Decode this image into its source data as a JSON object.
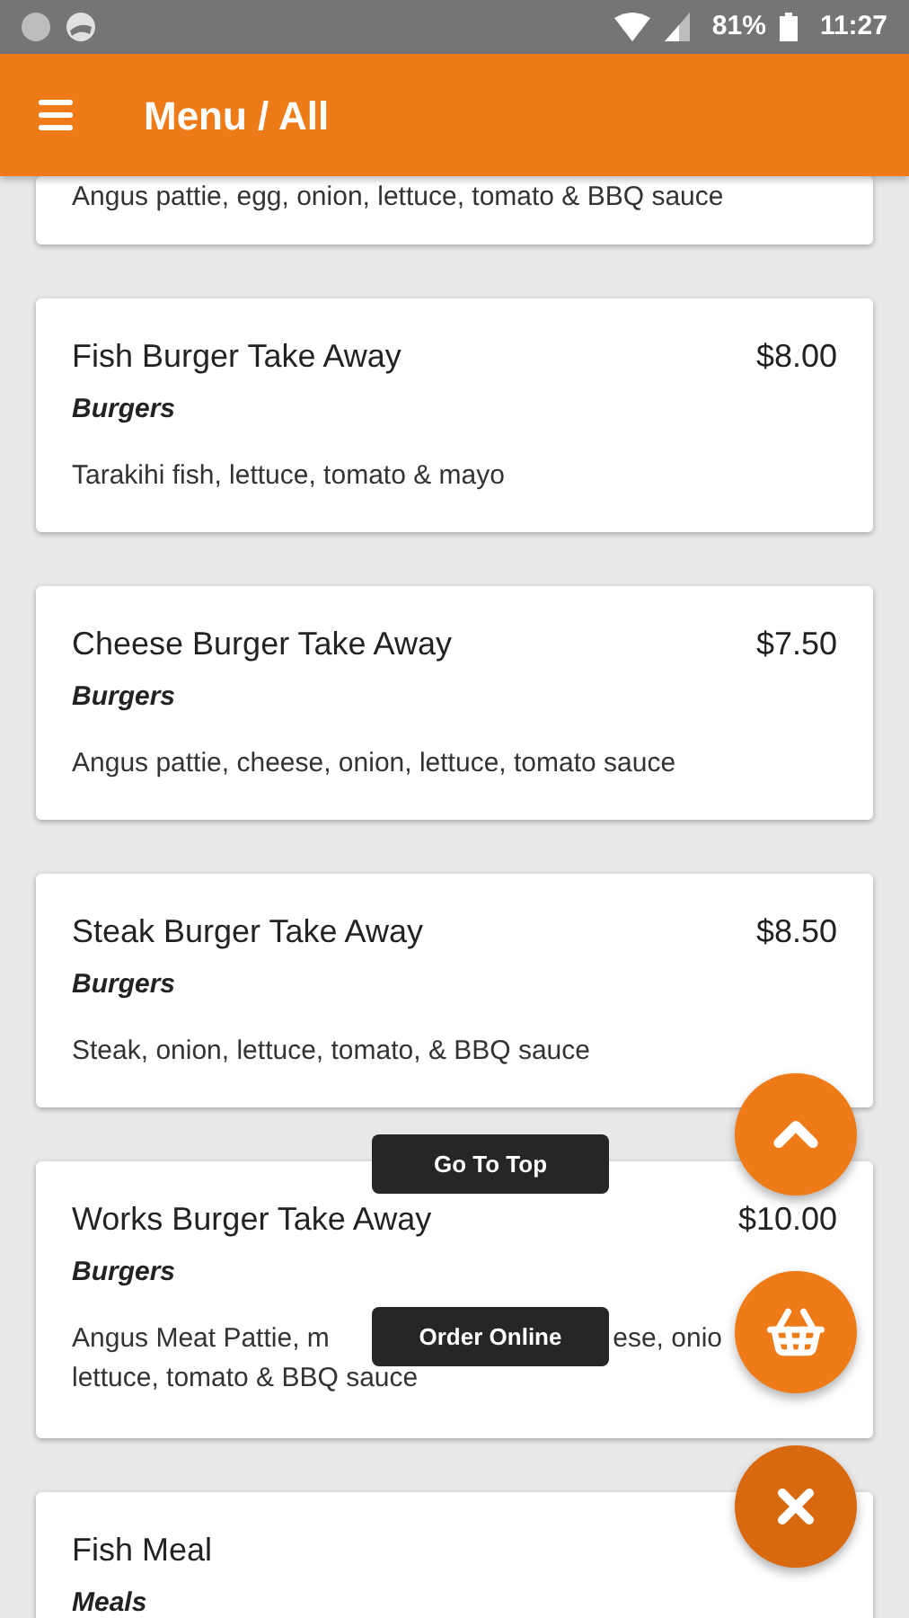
{
  "status_bar": {
    "battery": "81%",
    "time": "11:27"
  },
  "app_bar": {
    "title": "Menu / All"
  },
  "items": [
    {
      "kind": "partial",
      "description": "Angus pattie, egg, onion, lettuce, tomato & BBQ sauce"
    },
    {
      "kind": "full",
      "name": "Fish Burger Take Away",
      "price": "$8.00",
      "category": "Burgers",
      "description": "Tarakihi fish, lettuce, tomato & mayo"
    },
    {
      "kind": "full",
      "name": "Cheese Burger Take Away",
      "price": "$7.50",
      "category": "Burgers",
      "description": "Angus pattie, cheese, onion, lettuce, tomato sauce"
    },
    {
      "kind": "full",
      "name": "Steak Burger Take Away",
      "price": "$8.50",
      "category": "Burgers",
      "description": "Steak, onion, lettuce, tomato, & BBQ sauce"
    },
    {
      "kind": "covered",
      "name": "Works Burger Take Away",
      "price": "$10.00",
      "category": "Burgers",
      "description_parts": [
        "Angus Meat Pattie, m",
        "ese, onio"
      ],
      "description_line2": "lettuce, tomato & BBQ sauce"
    },
    {
      "kind": "full",
      "name": "Fish Meal",
      "category": "Meals"
    }
  ],
  "fab_menu": {
    "expanded": true,
    "actions": [
      {
        "label": "Go To Top",
        "kind": "up"
      },
      {
        "label": "Order Online",
        "kind": "basket"
      }
    ]
  }
}
